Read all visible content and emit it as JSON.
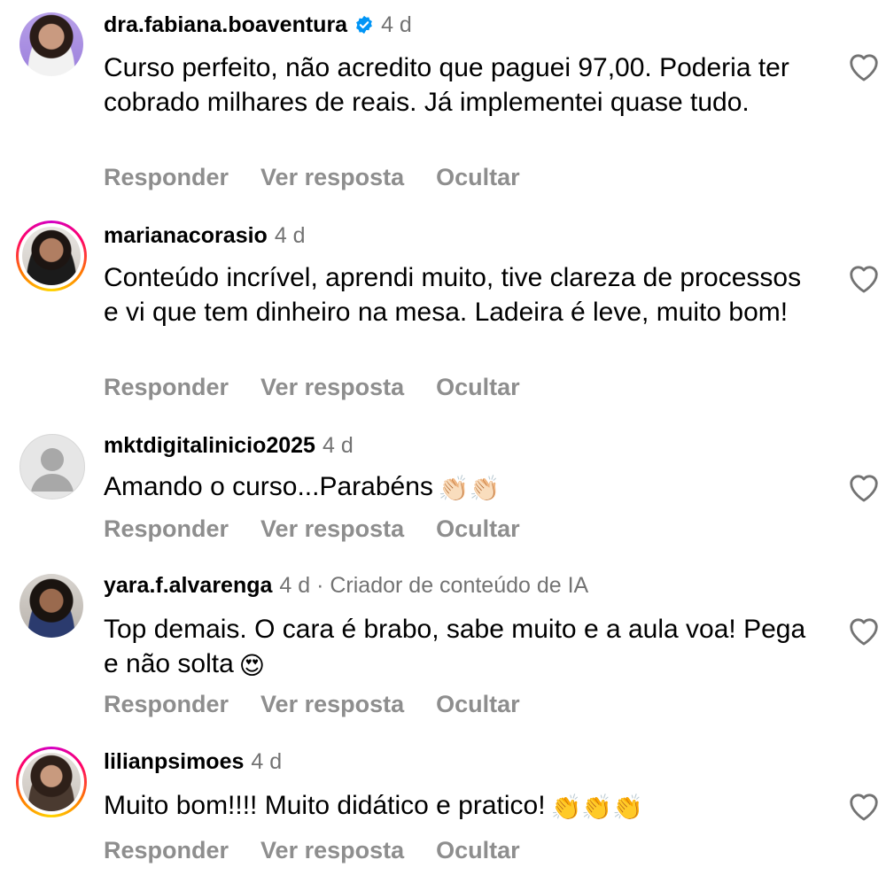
{
  "comments": [
    {
      "username": "dra.fabiana.boaventura",
      "time": "4 d",
      "verified": true,
      "text": "Curso perfeito, não acredito que paguei 97,00. Poderia ter cobrado milhares de reais. Já implementei quase tudo.",
      "reply": "Responder",
      "see_reply": "Ver resposta",
      "hide": "Ocultar"
    },
    {
      "username": "marianacorasio",
      "time": "4 d",
      "text": "Conteúdo incrível, aprendi muito, tive clareza de processos e vi que tem dinheiro na mesa. Ladeira é leve, muito bom!",
      "reply": "Responder",
      "see_reply": "Ver resposta",
      "hide": "Ocultar"
    },
    {
      "username": "mktdigitalinicio2025",
      "time": "4 d",
      "text": "Amando o curso...Parabéns",
      "emoji": "👏🏻👏🏻",
      "reply": "Responder",
      "see_reply": "Ver resposta",
      "hide": "Ocultar"
    },
    {
      "username": "yara.f.alvarenga",
      "time": "4 d · Criador de conteúdo de IA",
      "text": "Top demais. O cara é brabo, sabe muito e a aula voa! Pega e não solta",
      "emoji": "😍",
      "reply": "Responder",
      "see_reply": "Ver resposta",
      "hide": "Ocultar"
    },
    {
      "username": "lilianpsimoes",
      "time": "4 d",
      "text": "Muito bom!!!! Muito didático e pratico!",
      "emoji": "👏👏👏",
      "reply": "Responder",
      "see_reply": "Ver resposta",
      "hide": "Ocultar"
    }
  ],
  "colors": {
    "verified": "#0095f6",
    "muted": "#8e8e8e",
    "story_ring": "#ff0069"
  },
  "icons": {
    "like": "heart-outline-icon",
    "verified": "verified-badge-icon"
  }
}
